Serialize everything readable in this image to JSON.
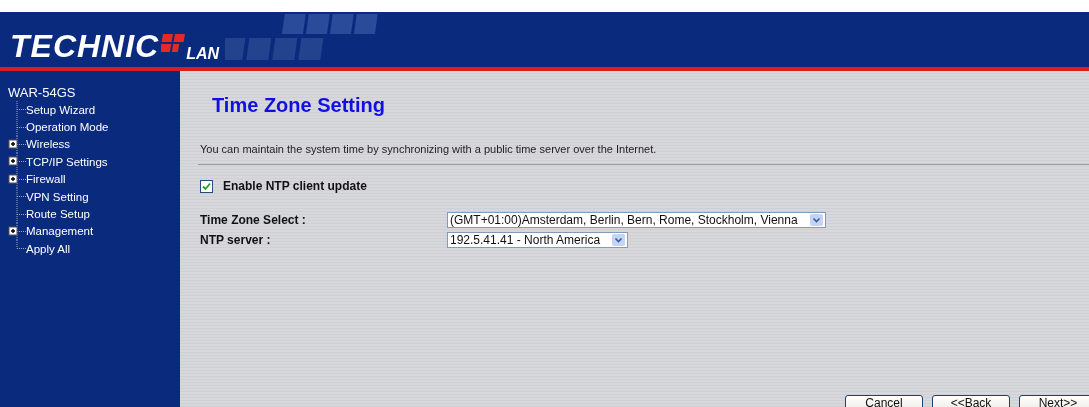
{
  "logo": {
    "left": "TECHNIC",
    "right": "LAN"
  },
  "sidebar": {
    "root": "WAR-54GS",
    "children": [
      {
        "label": "Setup Wizard",
        "kind": "page"
      },
      {
        "label": "Operation Mode",
        "kind": "page"
      },
      {
        "label": "Wireless",
        "kind": "folder"
      },
      {
        "label": "TCP/IP Settings",
        "kind": "folder"
      },
      {
        "label": "Firewall",
        "kind": "folder"
      },
      {
        "label": "VPN Setting",
        "kind": "page"
      },
      {
        "label": "Route Setup",
        "kind": "page"
      },
      {
        "label": "Management",
        "kind": "folder"
      },
      {
        "label": "Apply All",
        "kind": "page"
      }
    ]
  },
  "page": {
    "title": "Time Zone Setting",
    "description": "You can maintain the system time by synchronizing with a public time server over the Internet.",
    "enable_ntp": {
      "label": "Enable NTP client update",
      "checked": true
    },
    "fields": [
      {
        "label": "Time Zone Select :",
        "value": "(GMT+01:00)Amsterdam, Berlin, Bern, Rome, Stockholm, Vienna"
      },
      {
        "label": "NTP server :",
        "value": "192.5.41.41 - North America"
      }
    ]
  },
  "buttons": [
    "Cancel",
    "<<Back",
    "Next>>"
  ]
}
